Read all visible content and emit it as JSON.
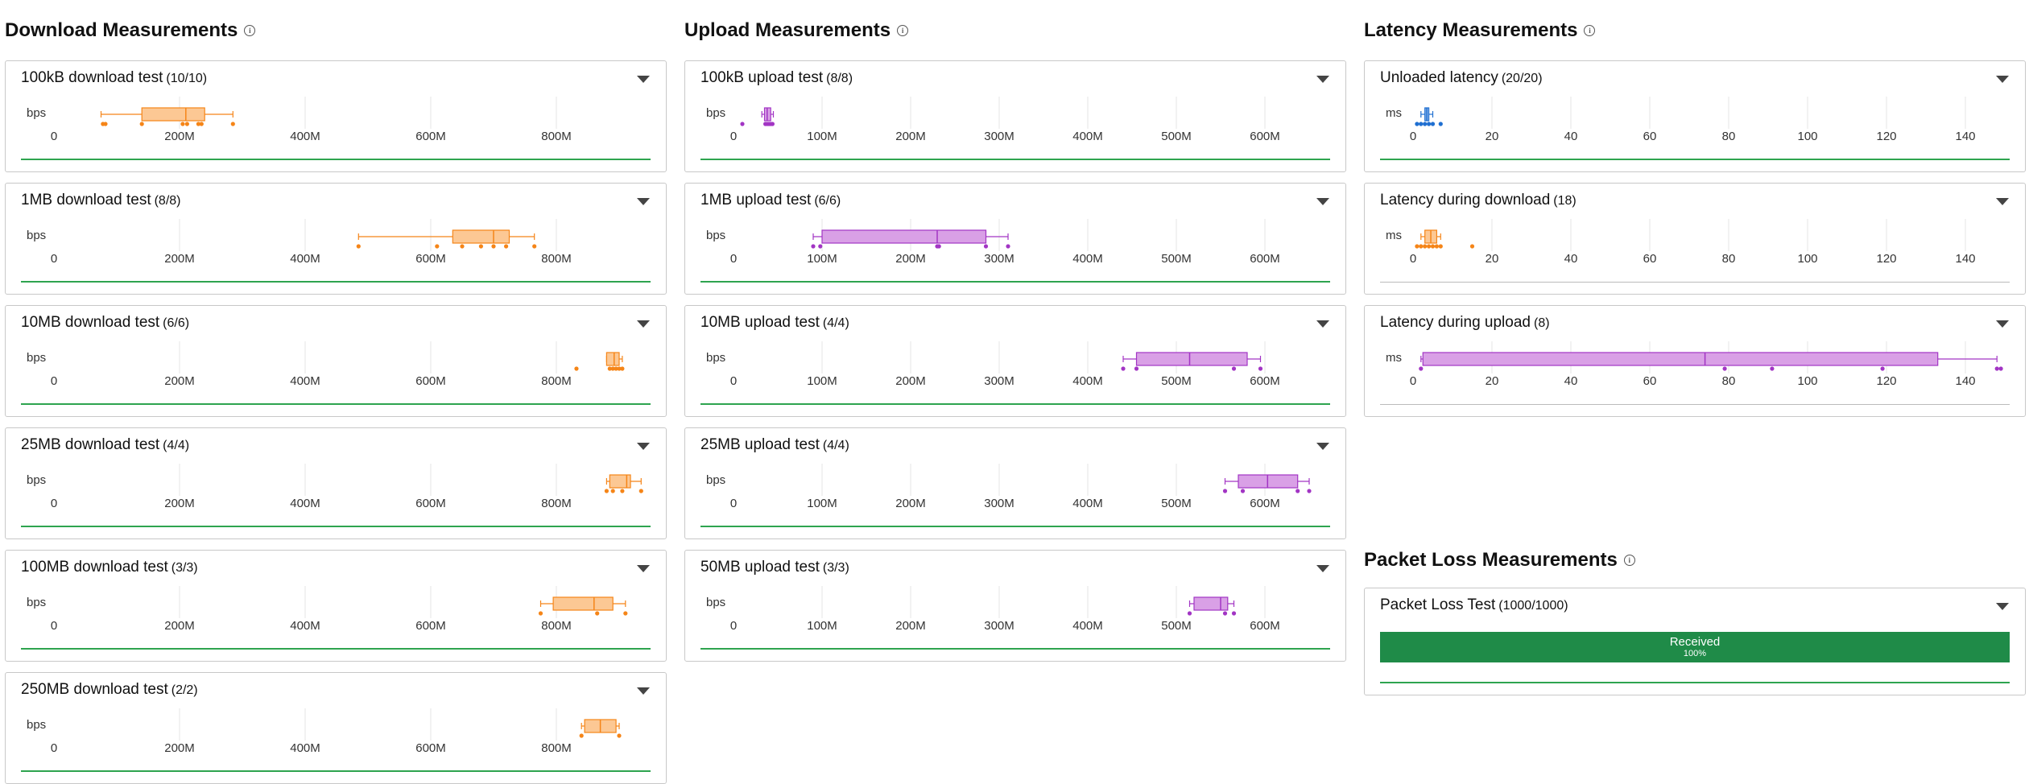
{
  "download": {
    "title": "Download Measurements",
    "color": "#f58518",
    "fill": "#fcc894",
    "ticks": [
      "0",
      "200M",
      "400M",
      "600M",
      "800M"
    ],
    "tick_values": [
      0,
      200,
      400,
      600,
      800
    ],
    "unit": "bps",
    "cards": [
      {
        "label": "100kB download test",
        "count": "(10/10)",
        "box": {
          "min": 75,
          "q1": 140,
          "median": 210,
          "q3": 240,
          "max": 285
        },
        "points": [
          78,
          82,
          140,
          205,
          212,
          230,
          235,
          285
        ]
      },
      {
        "label": "1MB download test",
        "count": "(8/8)",
        "box": {
          "min": 485,
          "q1": 635,
          "median": 700,
          "q3": 725,
          "max": 765
        },
        "points": [
          485,
          610,
          650,
          680,
          700,
          720,
          765
        ]
      },
      {
        "label": "10MB download test",
        "count": "(6/6)",
        "box": {
          "min": 880,
          "q1": 880,
          "median": 892,
          "q3": 900,
          "max": 905
        },
        "points": [
          832,
          885,
          890,
          895,
          900,
          905
        ]
      },
      {
        "label": "25MB download test",
        "count": "(4/4)",
        "box": {
          "min": 880,
          "q1": 885,
          "median": 912,
          "q3": 918,
          "max": 935
        },
        "points": [
          880,
          890,
          905,
          935
        ]
      },
      {
        "label": "100MB download test",
        "count": "(3/3)",
        "box": {
          "min": 775,
          "q1": 795,
          "median": 860,
          "q3": 890,
          "max": 910
        },
        "points": [
          775,
          865,
          910
        ]
      },
      {
        "label": "250MB download test",
        "count": "(2/2)",
        "box": {
          "min": 840,
          "q1": 845,
          "median": 870,
          "q3": 895,
          "max": 900
        },
        "points": [
          840,
          900
        ]
      }
    ]
  },
  "upload": {
    "title": "Upload Measurements",
    "color": "#a235c4",
    "fill": "#d9a0e6",
    "ticks": [
      "0",
      "100M",
      "200M",
      "300M",
      "400M",
      "500M",
      "600M"
    ],
    "tick_values": [
      0,
      100,
      200,
      300,
      400,
      500,
      600
    ],
    "unit": "bps",
    "cards": [
      {
        "label": "100kB upload test",
        "count": "(8/8)",
        "box": {
          "min": 32,
          "q1": 35,
          "median": 38,
          "q3": 42,
          "max": 45
        },
        "points": [
          10,
          36,
          38,
          40,
          42,
          44
        ]
      },
      {
        "label": "1MB upload test",
        "count": "(6/6)",
        "box": {
          "min": 90,
          "q1": 100,
          "median": 230,
          "q3": 285,
          "max": 310
        },
        "points": [
          90,
          98,
          230,
          232,
          285,
          310
        ]
      },
      {
        "label": "10MB upload test",
        "count": "(4/4)",
        "box": {
          "min": 440,
          "q1": 455,
          "median": 515,
          "q3": 580,
          "max": 595
        },
        "points": [
          440,
          455,
          565,
          595
        ]
      },
      {
        "label": "25MB upload test",
        "count": "(4/4)",
        "box": {
          "min": 555,
          "q1": 570,
          "median": 603,
          "q3": 637,
          "max": 650
        },
        "points": [
          555,
          575,
          637,
          650
        ]
      },
      {
        "label": "50MB upload test",
        "count": "(3/3)",
        "box": {
          "min": 515,
          "q1": 520,
          "median": 550,
          "q3": 558,
          "max": 565
        },
        "points": [
          515,
          555,
          565
        ]
      }
    ]
  },
  "latency": {
    "title": "Latency Measurements",
    "ticks": [
      "0",
      "20",
      "40",
      "60",
      "80",
      "100",
      "120",
      "140"
    ],
    "tick_values": [
      0,
      20,
      40,
      60,
      80,
      100,
      120,
      140
    ],
    "unit": "ms",
    "cards": [
      {
        "label": "Unloaded latency",
        "count": "(20/20)",
        "color": "#1f6fd1",
        "fill": "#8fb6ea",
        "baseline": "green",
        "box": {
          "min": 2,
          "q1": 3,
          "median": 3.5,
          "q3": 4,
          "max": 5
        },
        "points": [
          1,
          2,
          3,
          4,
          5,
          7
        ]
      },
      {
        "label": "Latency during download",
        "count": "(18)",
        "color": "#f58518",
        "fill": "#fcc894",
        "baseline": "gray",
        "box": {
          "min": 2,
          "q1": 3,
          "median": 4.5,
          "q3": 6,
          "max": 7
        },
        "points": [
          1,
          2,
          3,
          4,
          5,
          6,
          7,
          15
        ]
      },
      {
        "label": "Latency during upload",
        "count": "(8)",
        "color": "#a235c4",
        "fill": "#d9a0e6",
        "baseline": "gray",
        "box": {
          "min": 2,
          "q1": 2.5,
          "median": 74,
          "q3": 133,
          "max": 148
        },
        "points": [
          2,
          79,
          91,
          119,
          148,
          149
        ]
      }
    ]
  },
  "packet_loss": {
    "title": "Packet Loss Measurements",
    "card_label": "Packet Loss Test",
    "card_count": "(1000/1000)",
    "received_label": "Received",
    "received_pct": "100%",
    "received_fraction": 1.0,
    "color": "#1f8b48"
  }
}
